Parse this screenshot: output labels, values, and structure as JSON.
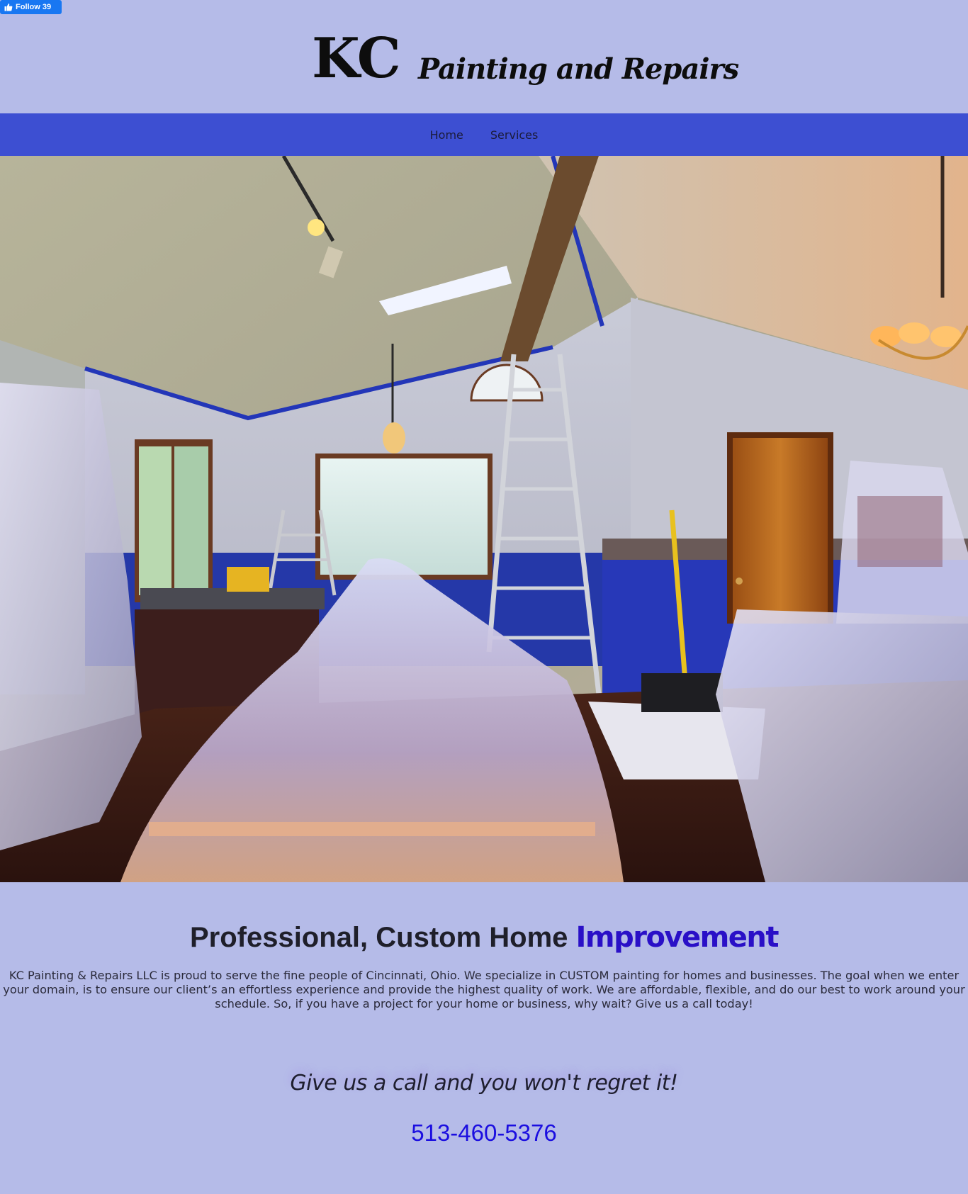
{
  "facebook": {
    "follow_label": "Follow 39"
  },
  "logo": {
    "kc": "KC",
    "tagline": "Painting and Repairs"
  },
  "nav": {
    "items": [
      {
        "label": "Home"
      },
      {
        "label": "Services"
      }
    ]
  },
  "hero": {
    "image_icon": "interior-painting-photo"
  },
  "main": {
    "heading_part1": "Professional, Custom Home",
    "heading_part2": "Improvement",
    "body": "KC Painting & Repairs LLC is proud to serve the fine people of Cincinnati, Ohio. We specialize in CUSTOM painting for homes and businesses. The goal when we enter your domain, is to ensure our client’s an effortless experience and provide the highest quality of work. We are affordable, flexible, and do our best to work around your schedule. So, if you have a project for your home or business, why wait? Give us a call today!",
    "call_tagline": "Give us a call and you won't regret it!",
    "phone": "513-460-5376"
  },
  "colors": {
    "page_bg": "#b5bbe8",
    "nav_bg": "#3d4fd2",
    "accent": "#2a10c7",
    "phone": "#1b0ee0"
  }
}
